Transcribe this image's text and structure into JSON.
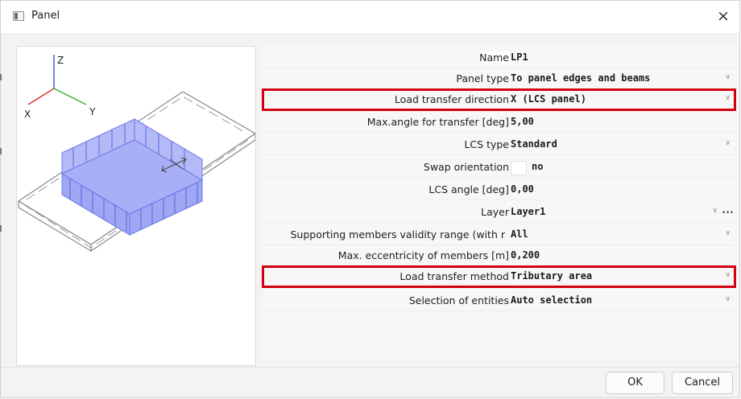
{
  "window": {
    "title": "Panel",
    "close_glyph": "×",
    "icon": "panel-app-icon"
  },
  "preview": {
    "axis_z": "Z",
    "axis_x": "X",
    "axis_y": "Y",
    "axis_colors": {
      "z": "#2a44cc",
      "x": "#e01010",
      "y": "#20b020"
    },
    "panel_fill": "#9fa8f5"
  },
  "properties": [
    {
      "label": "Name",
      "value": "LP1"
    },
    {
      "label": "Panel type",
      "value": "To panel edges and beams"
    },
    {
      "label": "Load transfer direction",
      "value": "X (LCS panel)"
    },
    {
      "label": "Max.angle for transfer [deg]",
      "value": "5,00"
    },
    {
      "label": "LCS type",
      "value": "Standard"
    },
    {
      "label": "Swap orientation",
      "value": "no"
    },
    {
      "label": "LCS angle [deg]",
      "value": "0,00"
    },
    {
      "label": "Layer",
      "value": "Layer1",
      "extra": "..."
    },
    {
      "label": "Supporting members validity range (with r",
      "value": "All"
    },
    {
      "label": "Max. eccentricity of members [m]",
      "value": "0,200"
    },
    {
      "label": "Load transfer method",
      "value": "Tributary area"
    },
    {
      "label": "Selection of entities",
      "value": "Auto selection"
    }
  ],
  "dropdown_glyph": "∨",
  "highlight_color": "#d4000f",
  "buttons": {
    "ok": "OK",
    "cancel": "Cancel"
  }
}
